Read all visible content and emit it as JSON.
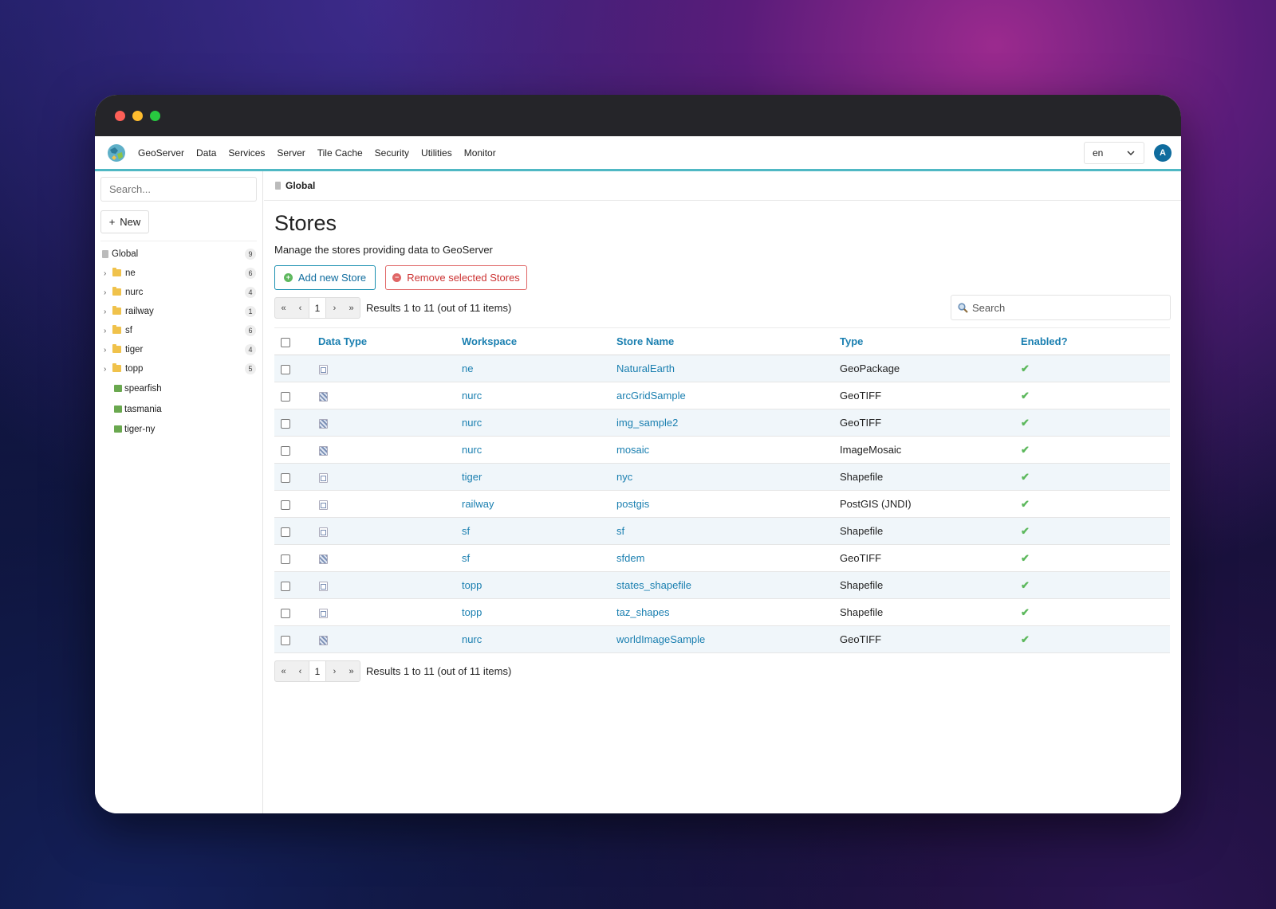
{
  "nav": {
    "items": [
      "GeoServer",
      "Data",
      "Services",
      "Server",
      "Tile Cache",
      "Security",
      "Utilities",
      "Monitor"
    ],
    "language": "en",
    "avatar_initial": "A"
  },
  "sidebar": {
    "search_placeholder": "Search...",
    "new_label": "New",
    "global": {
      "label": "Global",
      "count": "9"
    },
    "workspaces": [
      {
        "label": "ne",
        "count": "6"
      },
      {
        "label": "nurc",
        "count": "4"
      },
      {
        "label": "railway",
        "count": "1"
      },
      {
        "label": "sf",
        "count": "6"
      },
      {
        "label": "tiger",
        "count": "4"
      },
      {
        "label": "topp",
        "count": "5"
      }
    ],
    "stores": [
      "spearfish",
      "tasmania",
      "tiger-ny"
    ]
  },
  "breadcrumb": "Global",
  "page": {
    "title": "Stores",
    "description": "Manage the stores providing data to GeoServer",
    "add_button": "Add new Store",
    "remove_button": "Remove selected Stores",
    "search_placeholder": "Search",
    "pager": {
      "first": "«",
      "prev": "‹",
      "page": "1",
      "next": "›",
      "last": "»",
      "results_text": "Results 1 to 11 (out of 11 items)"
    }
  },
  "table": {
    "headers": {
      "data_type": "Data Type",
      "workspace": "Workspace",
      "store_name": "Store Name",
      "type": "Type",
      "enabled": "Enabled?"
    },
    "rows": [
      {
        "data_type": "vector",
        "workspace": "ne",
        "store_name": "NaturalEarth",
        "type": "GeoPackage",
        "enabled": "✔"
      },
      {
        "data_type": "raster",
        "workspace": "nurc",
        "store_name": "arcGridSample",
        "type": "GeoTIFF",
        "enabled": "✔"
      },
      {
        "data_type": "raster",
        "workspace": "nurc",
        "store_name": "img_sample2",
        "type": "GeoTIFF",
        "enabled": "✔"
      },
      {
        "data_type": "raster",
        "workspace": "nurc",
        "store_name": "mosaic",
        "type": "ImageMosaic",
        "enabled": "✔"
      },
      {
        "data_type": "vector",
        "workspace": "tiger",
        "store_name": "nyc",
        "type": "Shapefile",
        "enabled": "✔"
      },
      {
        "data_type": "vector",
        "workspace": "railway",
        "store_name": "postgis",
        "type": "PostGIS (JNDI)",
        "enabled": "✔"
      },
      {
        "data_type": "vector",
        "workspace": "sf",
        "store_name": "sf",
        "type": "Shapefile",
        "enabled": "✔"
      },
      {
        "data_type": "raster",
        "workspace": "sf",
        "store_name": "sfdem",
        "type": "GeoTIFF",
        "enabled": "✔"
      },
      {
        "data_type": "vector",
        "workspace": "topp",
        "store_name": "states_shapefile",
        "type": "Shapefile",
        "enabled": "✔"
      },
      {
        "data_type": "vector",
        "workspace": "topp",
        "store_name": "taz_shapes",
        "type": "Shapefile",
        "enabled": "✔"
      },
      {
        "data_type": "raster",
        "workspace": "nurc",
        "store_name": "worldImageSample",
        "type": "GeoTIFF",
        "enabled": "✔"
      }
    ]
  }
}
